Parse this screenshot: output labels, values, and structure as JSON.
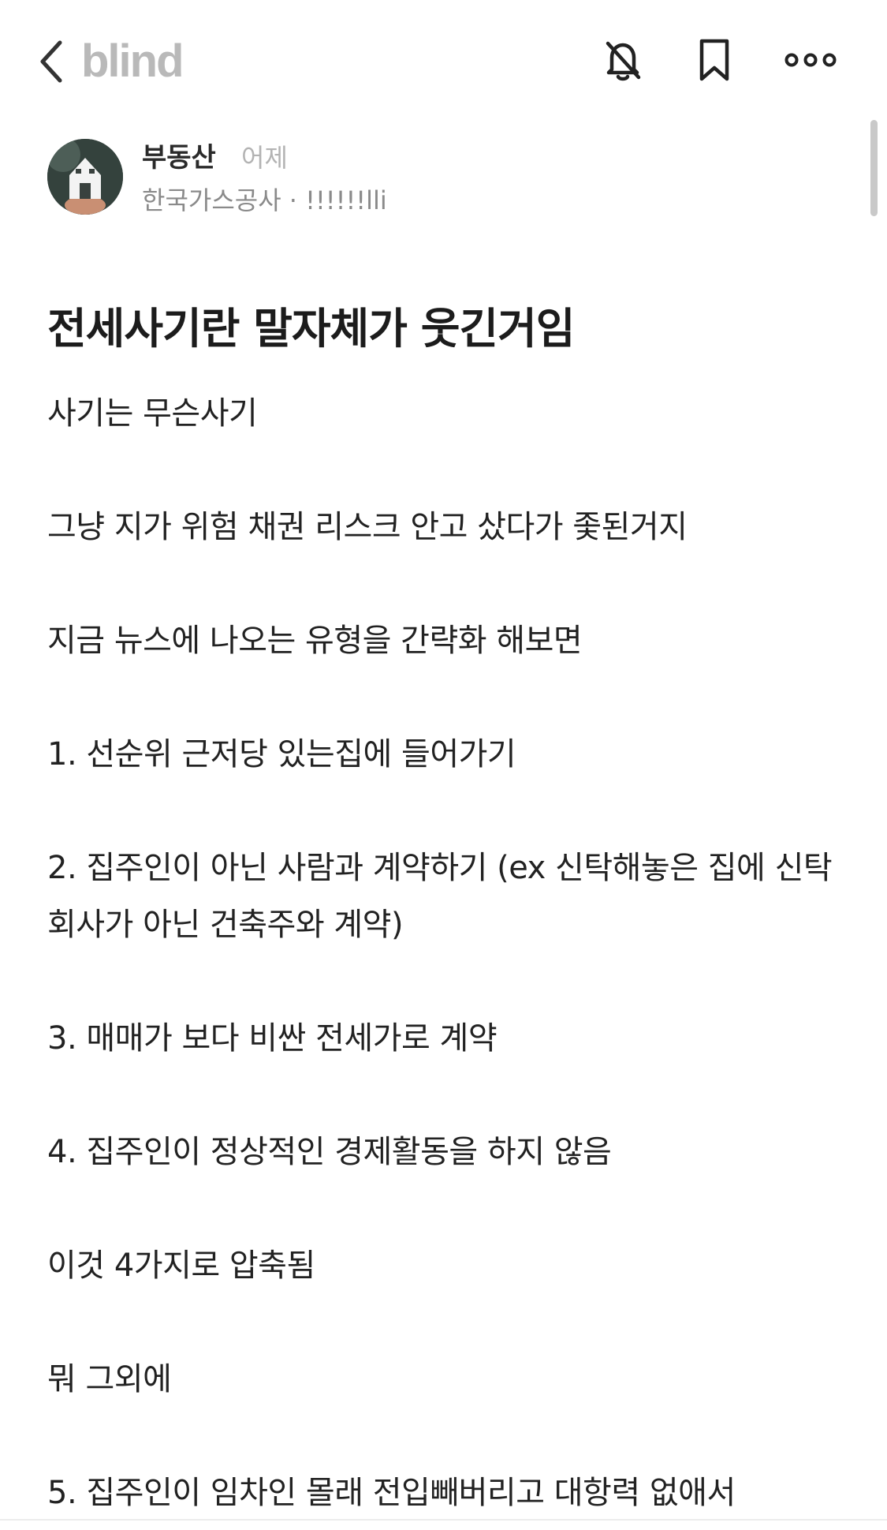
{
  "header": {
    "logo": "blind",
    "icons": [
      "chevron-left-icon",
      "bell-off-icon",
      "bookmark-icon",
      "more-horizontal-icon"
    ]
  },
  "author": {
    "name": "부동산",
    "time": "어제",
    "company_meta": "한국가스공사 · !!!!!!lli"
  },
  "post": {
    "title": "전세사기란 말자체가 웃긴거임",
    "paragraphs": [
      "사기는 무슨사기",
      "그냥 지가 위험 채권 리스크 안고 샀다가 좇된거지",
      "지금 뉴스에 나오는 유형을 간략화 해보면",
      "1. 선순위 근저당 있는집에 들어가기",
      "2. 집주인이 아닌 사람과 계약하기 (ex 신탁해놓은 집에 신탁회사가 아닌 건축주와 계약)",
      "3. 매매가 보다 비싼 전세가로 계약",
      "4. 집주인이 정상적인 경제활동을 하지 않음",
      "이것 4가지로 압축됨",
      "뭐 그외에",
      "5. 집주인이 임차인 몰래 전입빼버리고 대항력 없애서"
    ]
  },
  "colors": {
    "logo": "#b9b9b9",
    "text": "#222222",
    "muted": "#8a8a8a"
  }
}
